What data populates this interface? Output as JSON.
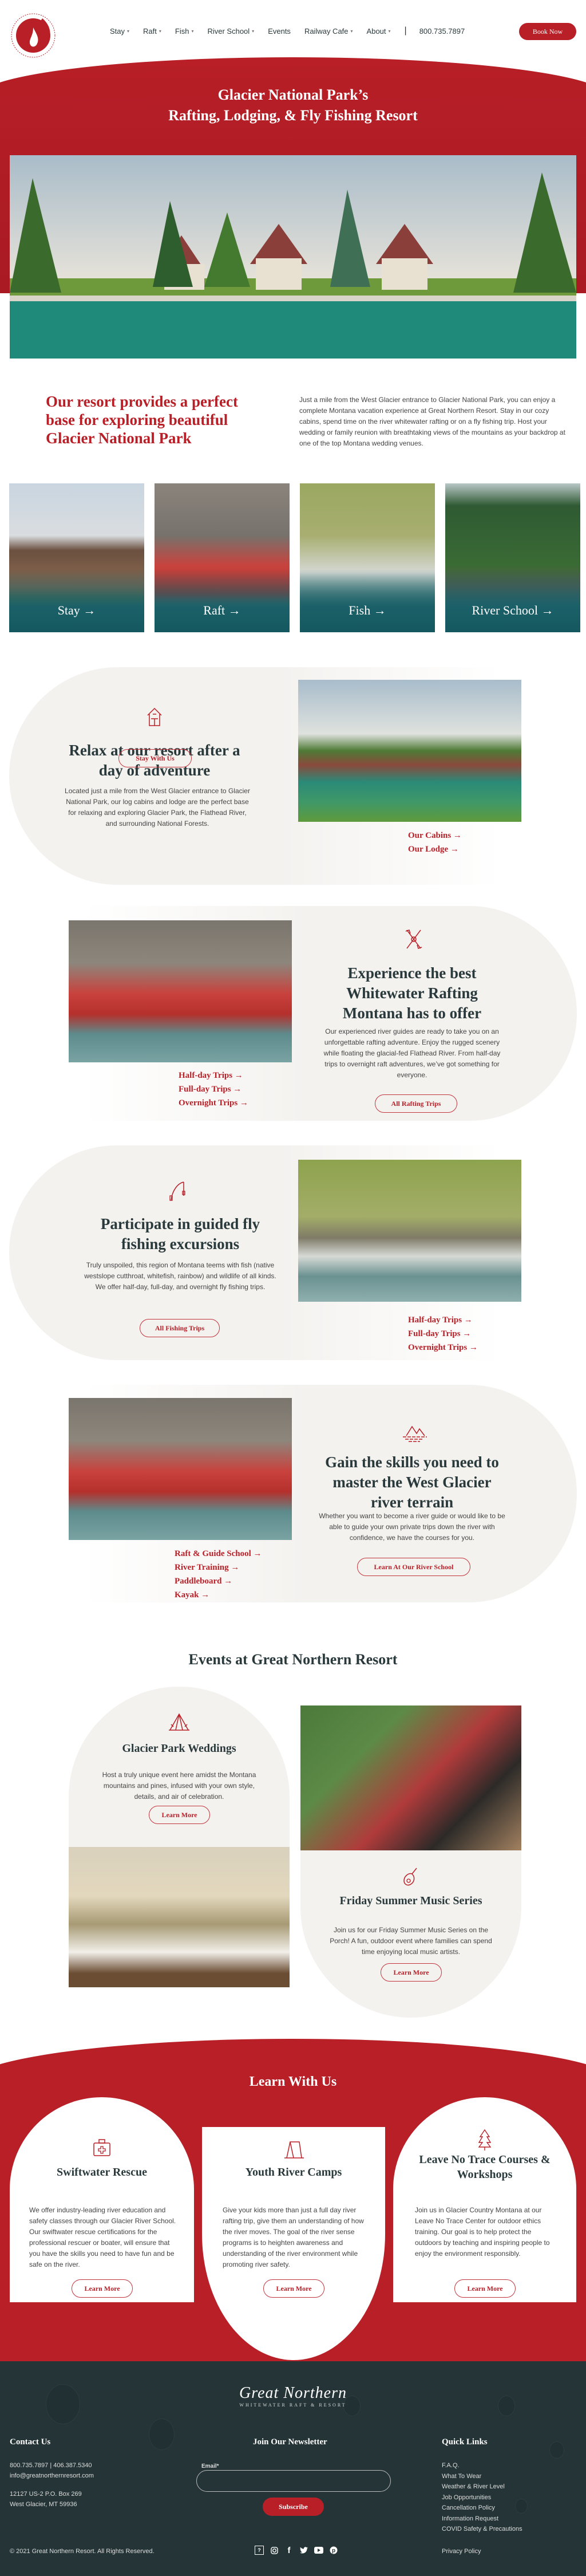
{
  "brand": {
    "name": "Great Northern Whitewater Raft & Resort",
    "accent": "#b81f27",
    "dark": "#243437",
    "cream": "#f4f2ef"
  },
  "nav": {
    "items": [
      {
        "label": "Stay",
        "dropdown": true
      },
      {
        "label": "Raft",
        "dropdown": true
      },
      {
        "label": "Fish",
        "dropdown": true
      },
      {
        "label": "River School",
        "dropdown": true
      },
      {
        "label": "Events",
        "dropdown": false
      },
      {
        "label": "Railway Cafe",
        "dropdown": true
      },
      {
        "label": "About",
        "dropdown": true
      }
    ],
    "separator": "|",
    "phone": "800.735.7897",
    "book_label": "Book Now"
  },
  "hero": {
    "title_line1": "Glacier National Park’s",
    "title_line2": "Rafting, Lodging, & Fly Fishing Resort"
  },
  "intro": {
    "heading": "Our resort provides a perfect base for exploring beautiful Glacier National Park",
    "body": "Just a mile from the West Glacier entrance to Glacier National Park, you can enjoy a complete Montana vacation experience at Great Northern Resort. Stay in our cozy cabins, spend time on the river whitewater rafting or on a fly fishing  trip. Host your wedding or family reunion with breathtaking views of the mountains as your backdrop at one of the top Montana wedding venues."
  },
  "tiles": [
    {
      "label": "Stay →"
    },
    {
      "label": "Raft →"
    },
    {
      "label": "Fish →"
    },
    {
      "label": "River School →"
    }
  ],
  "features": {
    "stay": {
      "icon": "cabin-icon",
      "heading": "Relax at our resort after a day of adventure",
      "body": "Located just a mile from the West Glacier entrance to Glacier National Park, our log cabins and lodge are the perfect base for relaxing and exploring Glacier Park, the Flathead River, and surrounding National Forests.",
      "button": "Stay With Us",
      "links": [
        "Our Cabins →",
        "Our Lodge →"
      ]
    },
    "raft": {
      "icon": "paddles-icon",
      "heading": "Experience the best Whitewater Rafting Montana has to offer",
      "body": "Our experienced river guides are ready to take you on an unforgettable rafting adventure. Enjoy the rugged scenery while floating the glacial-fed Flathead River. From half-day trips to overnight raft adventures, we’ve got something for everyone.",
      "button": "All Rafting Trips",
      "links": [
        "Half-day Trips →",
        "Full-day Trips →",
        "Overnight Trips →"
      ]
    },
    "fish": {
      "icon": "fishing-rod-icon",
      "heading": "Participate in guided fly fishing excursions",
      "body": "Truly unspoiled, this region of Montana teems with fish (native westslope cutthroat, whitefish, rainbow) and wildlife of all kinds. We offer half-day, full-day, and overnight fly fishing trips.",
      "button": "All Fishing Trips",
      "links": [
        "Half-day Trips →",
        "Full-day Trips →",
        "Overnight Trips →"
      ]
    },
    "school": {
      "icon": "mountain-river-icon",
      "heading": "Gain the skills you need to master the West Glacier river terrain",
      "body": "Whether you want to become a river guide or would like to be able to guide your own private trips down the river with confidence, we have the courses for you.",
      "button": "Learn At Our River School",
      "links": [
        "Raft & Guide School →",
        "River Training →",
        "Paddleboard →",
        "Kayak →"
      ]
    }
  },
  "events": {
    "heading": "Events at Great Northern Resort",
    "weddings": {
      "title": "Glacier Park Weddings",
      "body": "Host a truly unique event here amidst the Montana mountains and pines, infused with your own style, details, and air of celebration.",
      "button": "Learn More"
    },
    "music": {
      "title": "Friday Summer Music Series",
      "body": "Join us for our Friday Summer Music Series on the Porch! A fun, outdoor event where families can spend time enjoying local music artists.",
      "button": "Learn More"
    }
  },
  "learn": {
    "heading": "Learn With Us",
    "cards": [
      {
        "title": "Swiftwater Rescue",
        "body": "We offer industry-leading river education and safety classes through our Glacier River School. Our swiftwater rescue certifications for the professional rescuer or boater, will ensure that you have the skills you need to have fun and be safe on the river.",
        "button": "Learn More"
      },
      {
        "title": "Youth River Camps",
        "body": "Give your kids more than just a full day river rafting trip, give them an understanding of how the river moves. The goal of the river sense programs is to heighten awareness and understanding of the river environment while promoting river safety.",
        "button": "Learn More"
      },
      {
        "title": "Leave No Trace Courses & Workshops",
        "body": "Join us in Glacier Country Montana at our Leave No Trace Center for outdoor ethics training. Our goal is to help protect the outdoors by teaching and inspiring people to enjoy the environment responsibly.",
        "button": "Learn More"
      }
    ]
  },
  "footer": {
    "logo_main": "Great Northern",
    "logo_sub": "WHITEWATER RAFT & RESORT",
    "contact": {
      "heading": "Contact Us",
      "phones": "800.735.7897 | 406.387.5340",
      "email": "info@greatnorthernresort.com",
      "address1": "12127 US-2 P.O. Box 269",
      "address2": "West Glacier, MT 59936"
    },
    "newsletter": {
      "heading": "Join Our Newsletter",
      "email_label": "Email*",
      "email_value": "",
      "button": "Subscribe"
    },
    "quick_links": {
      "heading": "Quick Links",
      "items": [
        "F.A.Q.",
        "What To Wear",
        "Weather & River Level",
        "Job Opportunities",
        "Cancellation Policy",
        "Information Request",
        "COVID Safety & Precautions"
      ]
    },
    "copyright": "© 2021 Great Northern Resort. All Rights Reserved.",
    "privacy": "Privacy Policy",
    "socials": [
      "tripadvisor-icon",
      "instagram-icon",
      "facebook-icon",
      "twitter-icon",
      "youtube-icon",
      "pinterest-icon"
    ]
  }
}
